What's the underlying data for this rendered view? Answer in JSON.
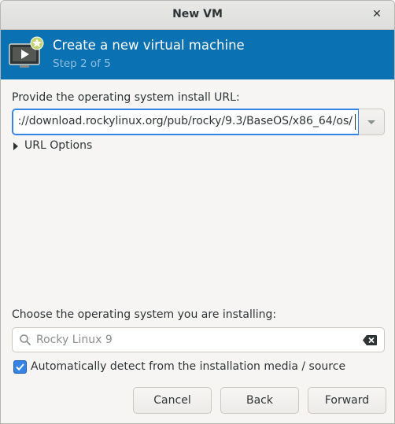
{
  "window": {
    "title": "New VM"
  },
  "banner": {
    "heading": "Create a new virtual machine",
    "step": "Step 2 of 5"
  },
  "install_url": {
    "label": "Provide the operating system install URL:",
    "value": "://download.rockylinux.org/pub/rocky/9.3/BaseOS/x86_64/os/"
  },
  "url_options": {
    "label": "URL Options"
  },
  "os_select": {
    "label": "Choose the operating system you are installing:",
    "value": "Rocky Linux 9"
  },
  "autodetect": {
    "label": "Automatically detect from the installation media / source",
    "checked": true
  },
  "buttons": {
    "cancel": "Cancel",
    "back": "Back",
    "forward": "Forward"
  },
  "colors": {
    "banner": "#0a71b3",
    "accent": "#3584e4"
  }
}
